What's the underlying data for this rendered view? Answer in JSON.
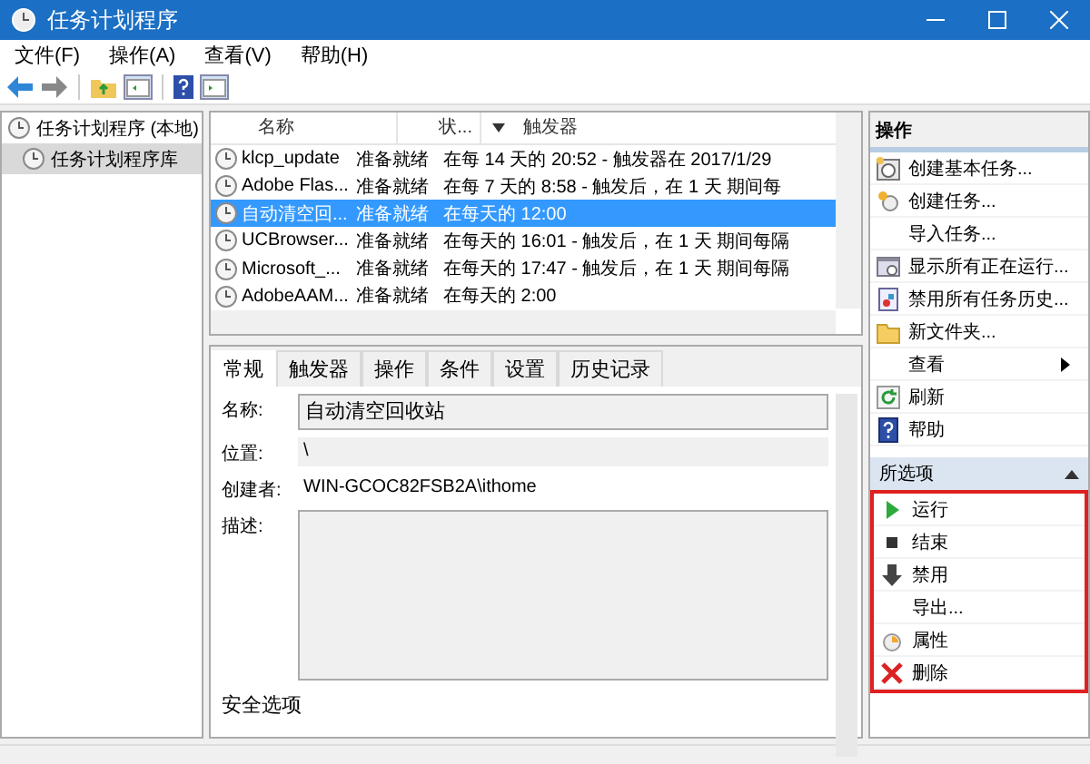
{
  "window": {
    "title": "任务计划程序"
  },
  "menu": [
    "文件(F)",
    "操作(A)",
    "查看(V)",
    "帮助(H)"
  ],
  "tree": [
    {
      "label": "任务计划程序 (本地)",
      "expanded": true,
      "selected": false,
      "children": [
        {
          "label": "任务计划程序库",
          "expanded": false,
          "selected": true
        }
      ]
    }
  ],
  "task_list": {
    "columns": [
      "名称",
      "状...",
      "触发器"
    ],
    "rows": [
      {
        "name": "klcp_update",
        "status": "准备就绪",
        "trigger": "在每 14 天的 20:52 - 触发器在 2017/1/29",
        "selected": false
      },
      {
        "name": "Adobe Flas...",
        "status": "准备就绪",
        "trigger": "在每 7 天的 8:58 - 触发后，在 1 天 期间每",
        "selected": false
      },
      {
        "name": "自动清空回...",
        "status": "准备就绪",
        "trigger": "在每天的 12:00",
        "selected": true
      },
      {
        "name": "UCBrowser...",
        "status": "准备就绪",
        "trigger": "在每天的 16:01 - 触发后，在 1 天 期间每隔",
        "selected": false
      },
      {
        "name": "Microsoft_...",
        "status": "准备就绪",
        "trigger": "在每天的 17:47 - 触发后，在 1 天 期间每隔",
        "selected": false
      },
      {
        "name": "AdobeAAM...",
        "status": "准备就绪",
        "trigger": "在每天的 2:00",
        "selected": false
      }
    ]
  },
  "detail_tabs": [
    {
      "label": "常规",
      "selected": true
    },
    {
      "label": "触发器",
      "selected": false
    },
    {
      "label": "操作",
      "selected": false
    },
    {
      "label": "条件",
      "selected": false
    },
    {
      "label": "设置",
      "selected": false
    },
    {
      "label": "历史记录",
      "selected": false
    }
  ],
  "general": {
    "name_label": "名称:",
    "name_value": "自动清空回收站",
    "location_label": "位置:",
    "location_value": "\\",
    "author_label": "创建者:",
    "author_value": "WIN-GCOC82FSB2A\\ithome",
    "description_label": "描述:",
    "security_label": "安全选项"
  },
  "actions_panel": {
    "title": "操作",
    "sections": [
      {
        "items": [
          {
            "label": "创建基本任务...",
            "kind": "basic-task"
          },
          {
            "label": "创建任务...",
            "kind": "task"
          },
          {
            "label": "导入任务...",
            "kind": "plain"
          },
          {
            "label": "显示所有正在运行...",
            "kind": "running"
          },
          {
            "label": "禁用所有任务历史...",
            "kind": "history"
          },
          {
            "label": "新文件夹...",
            "kind": "folder"
          },
          {
            "label": "查看",
            "kind": "submenu"
          },
          {
            "label": "刷新",
            "kind": "refresh"
          },
          {
            "label": "帮助",
            "kind": "help"
          }
        ]
      },
      {
        "title": "所选项",
        "expanded": true,
        "items": [
          {
            "label": "运行",
            "kind": "run"
          },
          {
            "label": "结束",
            "kind": "stop"
          },
          {
            "label": "禁用",
            "kind": "disable"
          },
          {
            "label": "导出...",
            "kind": "plain"
          },
          {
            "label": "属性",
            "kind": "properties"
          },
          {
            "label": "删除",
            "kind": "delete"
          }
        ]
      }
    ]
  }
}
